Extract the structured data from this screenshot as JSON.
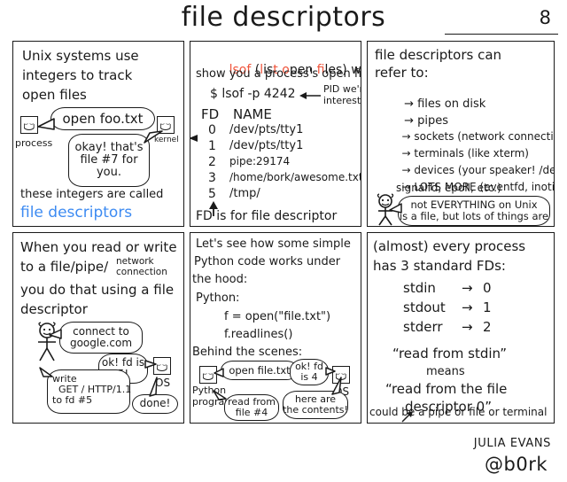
{
  "header": {
    "title": "file descriptors",
    "page_number": "8"
  },
  "panels": {
    "top_left": {
      "lines": [
        "Unix systems use",
        "integers to track",
        "open files"
      ],
      "process_label": "process",
      "kernel_label": "kernel",
      "bubble_open": "open foo.txt",
      "bubble_reply": "okay! that's\nfile #7 for\nyou.",
      "closing_line": "these integers are called",
      "closing_highlight": "file descriptors",
      "highlight_color": "#3d8bf2"
    },
    "top_middle": {
      "intro_cmd": "lsof",
      "intro_paren_open": "(",
      "intro_expand": [
        {
          "text": "l",
          "red": true
        },
        {
          "text": "is",
          "red": false
        },
        {
          "text": "t ",
          "red": true
        },
        {
          "text": "o",
          "red": true
        },
        {
          "text": "pen ",
          "red": false
        },
        {
          "text": "f",
          "red": true
        },
        {
          "text": "iles",
          "red": false
        }
      ],
      "intro_expand_plain": "(list open files) will",
      "intro_tail": "show you a process's open files",
      "command_line": "$ lsof -p 4242",
      "pid_note": "PID we're\ninterested in",
      "table_headers": [
        "FD",
        "NAME"
      ],
      "table_rows": [
        {
          "fd": "0",
          "name": "/dev/pts/tty1"
        },
        {
          "fd": "1",
          "name": "/dev/pts/tty1"
        },
        {
          "fd": "2",
          "name": "pipe:29174"
        },
        {
          "fd": "3",
          "name": "/home/bork/awesome.txt"
        },
        {
          "fd": "5",
          "name": "/tmp/"
        }
      ],
      "footnote": "FD is for file descriptor",
      "accent_color": "#f0553c"
    },
    "top_right": {
      "heading": [
        "file descriptors can",
        "refer to:"
      ],
      "bullets": [
        "files on disk",
        "pipes",
        "sockets (network connections)",
        "terminals (like xterm)",
        "devices (your speaker! /dev/null!)",
        "LOTS MORE (eventfd, inotify,"
      ],
      "bullet_continuation": "signalfd, epoll, etc.)",
      "bubble": "not EVERYTHING on Unix\nis a file, but lots of things are"
    },
    "bottom_left": {
      "lines": [
        "When you read or write",
        "to a file/pipe/",
        "you do that using a file",
        "descriptor"
      ],
      "superscript": "network\nconnection",
      "bubble_connect": "connect to\ngoogle.com",
      "bubble_ok": "ok! fd is\n5!",
      "bubble_write": "write\n  GET / HTTP/1.1\nto fd #5",
      "bubble_done": "done!",
      "os_label": "OS"
    },
    "bottom_middle": {
      "lines": [
        "Let's see how some simple",
        "Python code works under",
        "the hood:"
      ],
      "python_label": "Python:",
      "code_lines": [
        "f = open(\"file.txt\")",
        "f.readlines()"
      ],
      "behind_label": "Behind the scenes:",
      "bubble_open": "open file.txt",
      "bubble_ok": "ok! fd\nis 4",
      "bubble_read": "read from\nfile #4",
      "bubble_contents": "here are\nthe contents!",
      "program_label": "Python\nprogram",
      "os_label": "OS"
    },
    "bottom_right": {
      "lines": [
        "(almost) every process",
        "has 3 standard FDs:"
      ],
      "fd_table": [
        {
          "name": "stdin",
          "arrow": "→",
          "value": "0"
        },
        {
          "name": "stdout",
          "arrow": "→",
          "value": "1"
        },
        {
          "name": "stderr",
          "arrow": "→",
          "value": "2"
        }
      ],
      "quote_line1": "“read from stdin”",
      "quote_means": "means",
      "quote_line2": "“read from the file",
      "quote_line3": "descriptor 0”",
      "footnote": "could be a pipe or file or terminal"
    }
  },
  "signature": {
    "author": "JULIA EVANS",
    "handle": "@b0rk"
  }
}
